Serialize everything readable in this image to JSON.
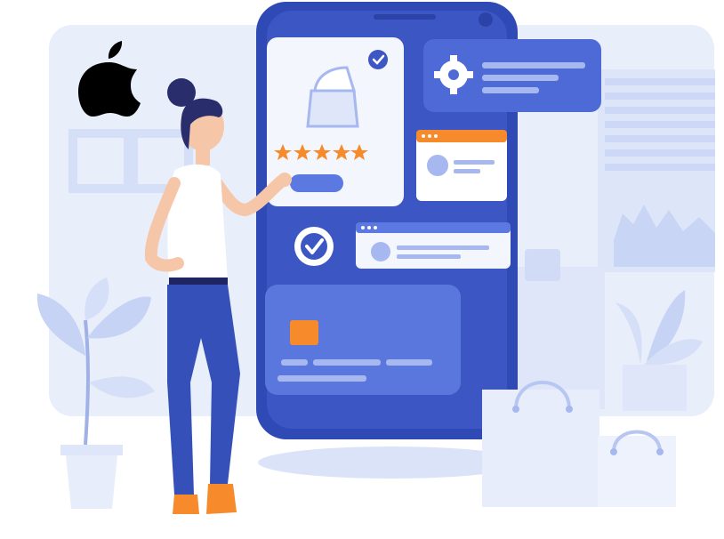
{
  "illustration": {
    "subject": "mobile-shopping-app",
    "rating": {
      "stars_filled": 5,
      "stars_total": 5
    },
    "icons": [
      "apple-logo",
      "gear-icon",
      "checkmark-icon",
      "product-bag-icon",
      "star-icon",
      "credit-card-icon",
      "shopping-bag-icon",
      "plant-icon"
    ]
  },
  "colors": {
    "background": "#e7edfb",
    "background_dark": "#d6e0f8",
    "phone_body": "#3c56c4",
    "phone_screen": "#2f49b5",
    "accent_blue": "#5b79e0",
    "light_blue": "#a6b8ef",
    "orange": "#f78a2a",
    "white": "#ffffff",
    "skin": "#f6c6a8",
    "hair": "#2a2d6b",
    "pants": "#3551b9"
  }
}
